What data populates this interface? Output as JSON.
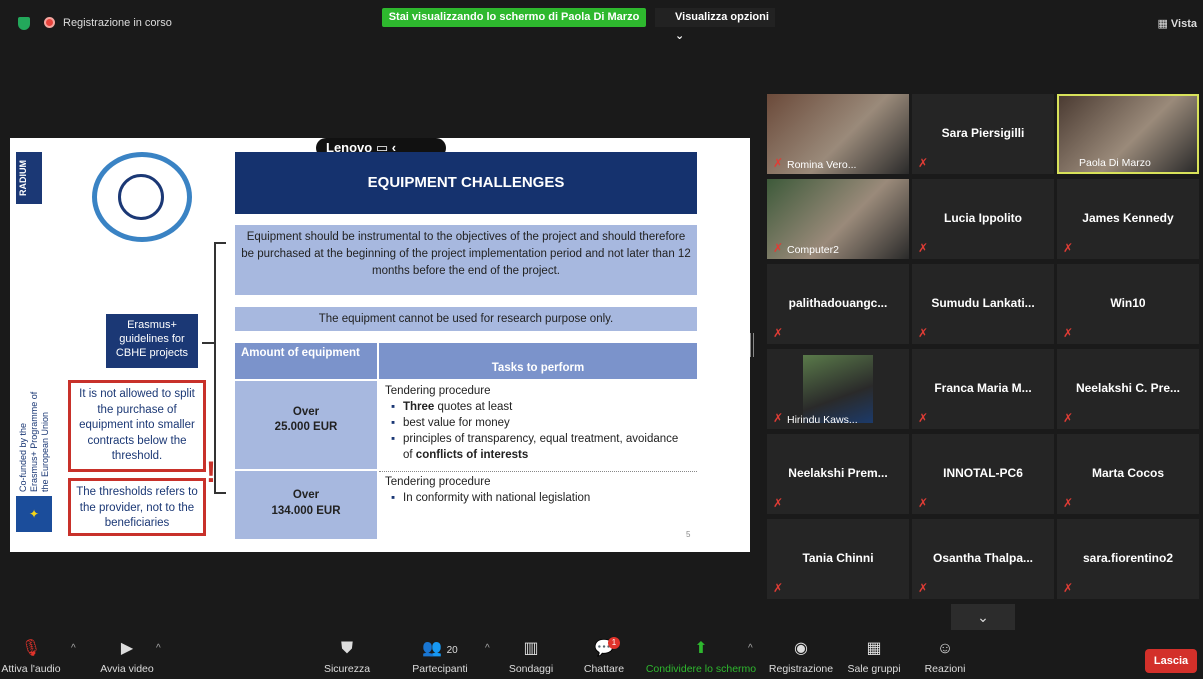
{
  "topbar": {
    "recording_label": "Registrazione in corso",
    "share_banner": "Stai visualizzando lo schermo di Paola Di Marzo",
    "view_options": "Visualizza opzioni ⌄",
    "view_label": "Vista"
  },
  "slide": {
    "brand": "Lenovo",
    "radium": "RADIUM",
    "title": "EQUIPMENT CHALLENGES",
    "paragraph": "Equipment should be instrumental to the objectives of the project and should therefore be purchased at the beginning of the project implementation period and not later than 12 months before the end of the project.",
    "cannot": "The equipment cannot be used for research purpose only.",
    "erasmus_box": "Erasmus+ guidelines for CBHE projects",
    "warning1": "It is not allowed to split the purchase of equipment into smaller contracts below the threshold.",
    "warning2": "The thresholds refers to the provider, not to the beneficiaries",
    "cofunded": "Co-funded by the Erasmus+ Programme of the European Union",
    "page_number": "5",
    "table": {
      "header_amount": "Amount of equipment",
      "header_tasks": "Tasks to perform",
      "row1_amount_a": "Over",
      "row1_amount_b": "25.000 EUR",
      "row1_title": "Tendering procedure",
      "row1_b1_bold": "Three",
      "row1_b1_rest": " quotes at least",
      "row1_b2": "best value for money",
      "row1_b3_a": "principles of transparency, equal treatment, avoidance of ",
      "row1_b3_bold": "conflicts of interests",
      "row2_amount_a": "Over",
      "row2_amount_b": "134.000 EUR",
      "row2_title": "Tendering procedure",
      "row2_b1": "In conformity with national legislation"
    }
  },
  "participants": [
    {
      "name": "Romina Vero...",
      "video": true
    },
    {
      "name": "Sara Piersigilli",
      "video": false
    },
    {
      "name": "Paola Di Marzo",
      "video": true,
      "active_speaker": true
    },
    {
      "name": "Computer2",
      "video": true
    },
    {
      "name": "Lucia Ippolito",
      "video": false
    },
    {
      "name": "James Kennedy",
      "video": false
    },
    {
      "name": "palithadouangc...",
      "video": false
    },
    {
      "name": "Sumudu Lankati...",
      "video": false
    },
    {
      "name": "Win10",
      "video": false
    },
    {
      "name": "Hirindu Kaws...",
      "video": true
    },
    {
      "name": "Franca Maria M...",
      "video": false
    },
    {
      "name": "Neelakshi C. Pre...",
      "video": false
    },
    {
      "name": "Neelakshi Prem...",
      "video": false
    },
    {
      "name": "INNOTAL-PC6",
      "video": false
    },
    {
      "name": "Marta Cocos",
      "video": false
    },
    {
      "name": "Tania Chinni",
      "video": false
    },
    {
      "name": "Osantha Thalpa...",
      "video": false
    },
    {
      "name": "sara.fiorentino2",
      "video": false
    }
  ],
  "toolbar": {
    "audio": "Attiva l'audio",
    "video": "Avvia video",
    "security": "Sicurezza",
    "participants": "Partecipanti",
    "participants_count": "20",
    "polls": "Sondaggi",
    "chat": "Chattare",
    "chat_badge": "1",
    "share": "Condividere lo schermo",
    "record": "Registrazione",
    "breakout": "Sale gruppi",
    "reactions": "Reazioni",
    "leave": "Lascia"
  },
  "colors": {
    "share_green": "#2eb82e",
    "leave_red": "#d3302a",
    "slide_navy": "#15326e",
    "slide_light_blue": "#a7b8df",
    "speaker_highlight": "#d8e25a"
  }
}
